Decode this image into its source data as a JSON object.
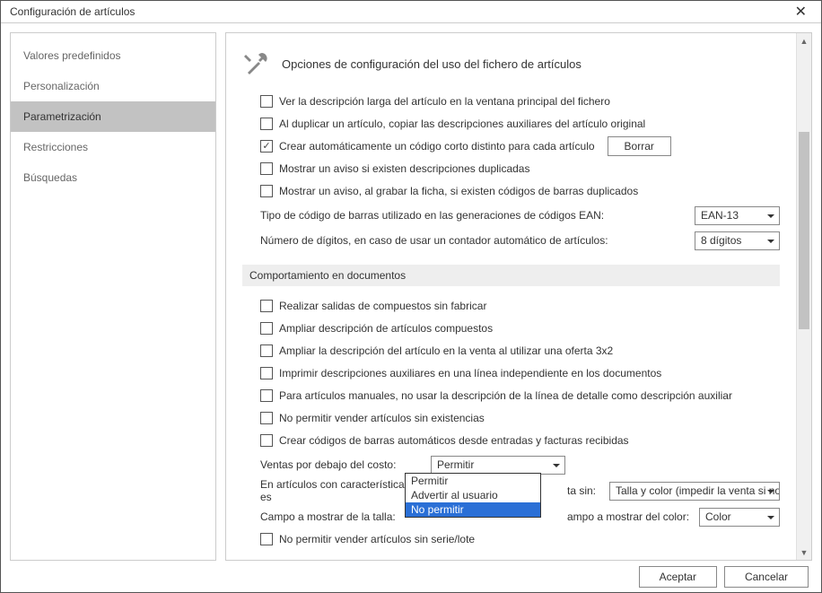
{
  "window_title": "Configuración de artículos",
  "sidebar": {
    "items": [
      {
        "label": "Valores predefinidos"
      },
      {
        "label": "Personalización"
      },
      {
        "label": "Parametrización"
      },
      {
        "label": "Restricciones"
      },
      {
        "label": "Búsquedas"
      }
    ]
  },
  "main": {
    "heading": "Opciones de configuración del uso del fichero de artículos",
    "opts1": {
      "see_long_desc": "Ver la descripción larga del artículo en la ventana principal del fichero",
      "dup_copy_aux": "Al duplicar un artículo, copiar las descripciones auxiliares del artículo original",
      "auto_short_code": "Crear automáticamente un código corto distinto para cada artículo",
      "borrar": "Borrar",
      "warn_dup_desc": "Mostrar un aviso si existen descripciones duplicadas",
      "warn_dup_barcode": "Mostrar un aviso, al grabar la ficha, si existen códigos de barras duplicados",
      "barcode_type_label": "Tipo de código de barras utilizado en las generaciones de códigos EAN:",
      "barcode_type_value": "EAN-13",
      "digits_label": "Número de dígitos, en caso de usar un contador automático de artículos:",
      "digits_value": "8 dígitos"
    },
    "sub_heading": "Comportamiento en documentos",
    "opts2": {
      "salidas_compuestos": "Realizar salidas de compuestos sin fabricar",
      "ampliar_comp": "Ampliar descripción de artículos compuestos",
      "ampliar_3x2": "Ampliar la descripción del artículo en la venta al utilizar una oferta 3x2",
      "imprimir_aux": "Imprimir descripciones auxiliares en una línea independiente en los documentos",
      "manuales_no_detalle": "Para artículos manuales, no usar la descripción de la línea de detalle como descripción auxiliar",
      "no_vender_sin_exist": "No permitir vender artículos sin existencias",
      "barcodes_auto_entrada": "Crear códigos de barras automáticos desde entradas y facturas recibidas",
      "ventas_below_cost_label": "Ventas por debajo del costo:",
      "ventas_below_cost_value": "Permitir",
      "caracteristicas_label_left": "En artículos con características es",
      "caracteristicas_label_right": "ta sin:",
      "caracteristicas_value": "Talla y color (impedir la venta si no s",
      "campo_talla_label": "Campo a mostrar de la talla:",
      "campo_color_label": "ampo a mostrar del color:",
      "campo_color_value": "Color",
      "no_vender_sin_serie": "No permitir vender artículos sin serie/lote"
    },
    "dropdown": {
      "opt1": "Permitir",
      "opt2": "Advertir al usuario",
      "opt3": "No permitir"
    }
  },
  "footer": {
    "ok": "Aceptar",
    "cancel": "Cancelar"
  }
}
